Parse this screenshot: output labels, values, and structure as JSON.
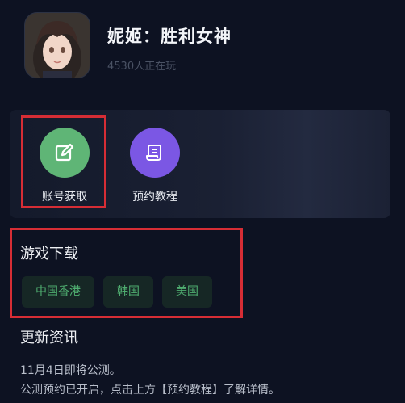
{
  "game": {
    "title": "妮姬：胜利女神",
    "players_online": "4530人正在玩"
  },
  "actions": [
    {
      "label": "账号获取",
      "icon": "edit-icon",
      "color": "#5fb576"
    },
    {
      "label": "预约教程",
      "icon": "scroll-icon",
      "color": "#7b57e4"
    }
  ],
  "download": {
    "heading": "游戏下载",
    "regions": [
      "中国香港",
      "韩国",
      "美国"
    ]
  },
  "news": {
    "heading": "更新资讯",
    "lines": [
      "11月4日即将公测。",
      "公测预约已开启，点击上方【预约教程】了解详情。"
    ]
  },
  "colors": {
    "highlight_border": "#d62d35",
    "region_text": "#4fae70",
    "background": "#0d1222"
  }
}
